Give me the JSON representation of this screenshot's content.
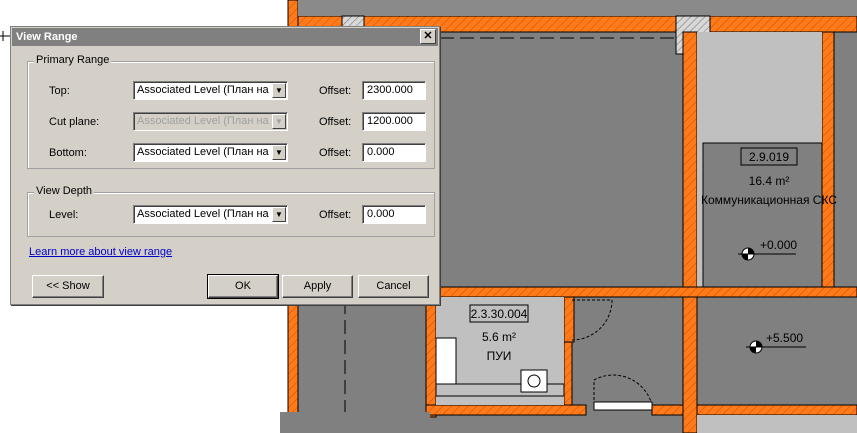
{
  "dialog": {
    "title": "View Range",
    "close_glyph": "✕",
    "primary_range": {
      "legend": "Primary Range",
      "rows": [
        {
          "label": "Top:",
          "level": "Associated Level (План на с",
          "offset_label": "Offset:",
          "offset": "2300.000",
          "disabled": false
        },
        {
          "label": "Cut plane:",
          "level": "Associated Level (План на с",
          "offset_label": "Offset:",
          "offset": "1200.000",
          "disabled": true
        },
        {
          "label": "Bottom:",
          "level": "Associated Level (План на с",
          "offset_label": "Offset:",
          "offset": "0.000",
          "disabled": false
        }
      ]
    },
    "view_depth": {
      "legend": "View Depth",
      "row": {
        "label": "Level:",
        "level": "Associated Level (План на с",
        "offset_label": "Offset:",
        "offset": "0.000"
      }
    },
    "learn_more": "Learn more about view range",
    "buttons": {
      "show": "<< Show",
      "ok": "OK",
      "apply": "Apply",
      "cancel": "Cancel"
    }
  },
  "plan": {
    "rooms": [
      {
        "number": "2.9.019",
        "area": "16.4 m²",
        "name": "Коммуникационная СКС"
      },
      {
        "number": "2.3.30.004",
        "area": "5.6 m²",
        "name": "ПУИ"
      }
    ],
    "elevations": [
      "+0.000",
      "+5.500"
    ]
  },
  "colors": {
    "wall_orange": "#ff7a1a",
    "floor_dark": "#808080",
    "floor_light": "#c0c0c0",
    "dialog_face": "#d4d0c8",
    "title_bar": "#808080",
    "link": "#0000cc"
  }
}
